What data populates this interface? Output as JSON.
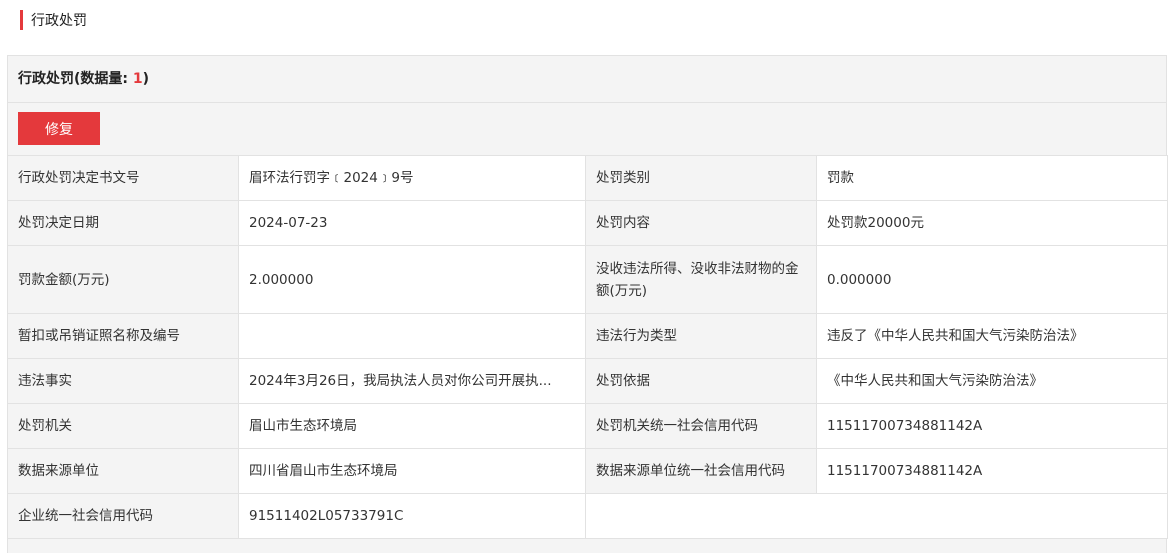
{
  "section": {
    "title": "行政处罚"
  },
  "panel": {
    "title_prefix": "行政处罚(数据量: ",
    "count": "1",
    "title_suffix": ")",
    "repair_button": "修复"
  },
  "rows": [
    {
      "l1": "行政处罚决定书文号",
      "v1": "眉环法行罚字﹝2024﹞9号",
      "l2": "处罚类别",
      "v2": "罚款"
    },
    {
      "l1": "处罚决定日期",
      "v1": "2024-07-23",
      "l2": "处罚内容",
      "v2": "处罚款20000元"
    },
    {
      "l1": "罚款金额(万元)",
      "v1": "2.000000",
      "l2": "没收违法所得、没收非法财物的金额(万元)",
      "v2": "0.000000"
    },
    {
      "l1": "暂扣或吊销证照名称及编号",
      "v1": "",
      "l2": "违法行为类型",
      "v2": "违反了《中华人民共和国大气污染防治法》"
    },
    {
      "l1": "违法事实",
      "v1": "2024年3月26日，我局执法人员对你公司开展执...",
      "l2": "处罚依据",
      "v2": "《中华人民共和国大气污染防治法》"
    },
    {
      "l1": "处罚机关",
      "v1": "眉山市生态环境局",
      "l2": "处罚机关统一社会信用代码",
      "v2": "11511700734881142A"
    },
    {
      "l1": "数据来源单位",
      "v1": "四川省眉山市生态环境局",
      "l2": "数据来源单位统一社会信用代码",
      "v2": "11511700734881142A"
    },
    {
      "l1": "企业统一社会信用代码",
      "v1": "91511402L05733791C"
    }
  ]
}
